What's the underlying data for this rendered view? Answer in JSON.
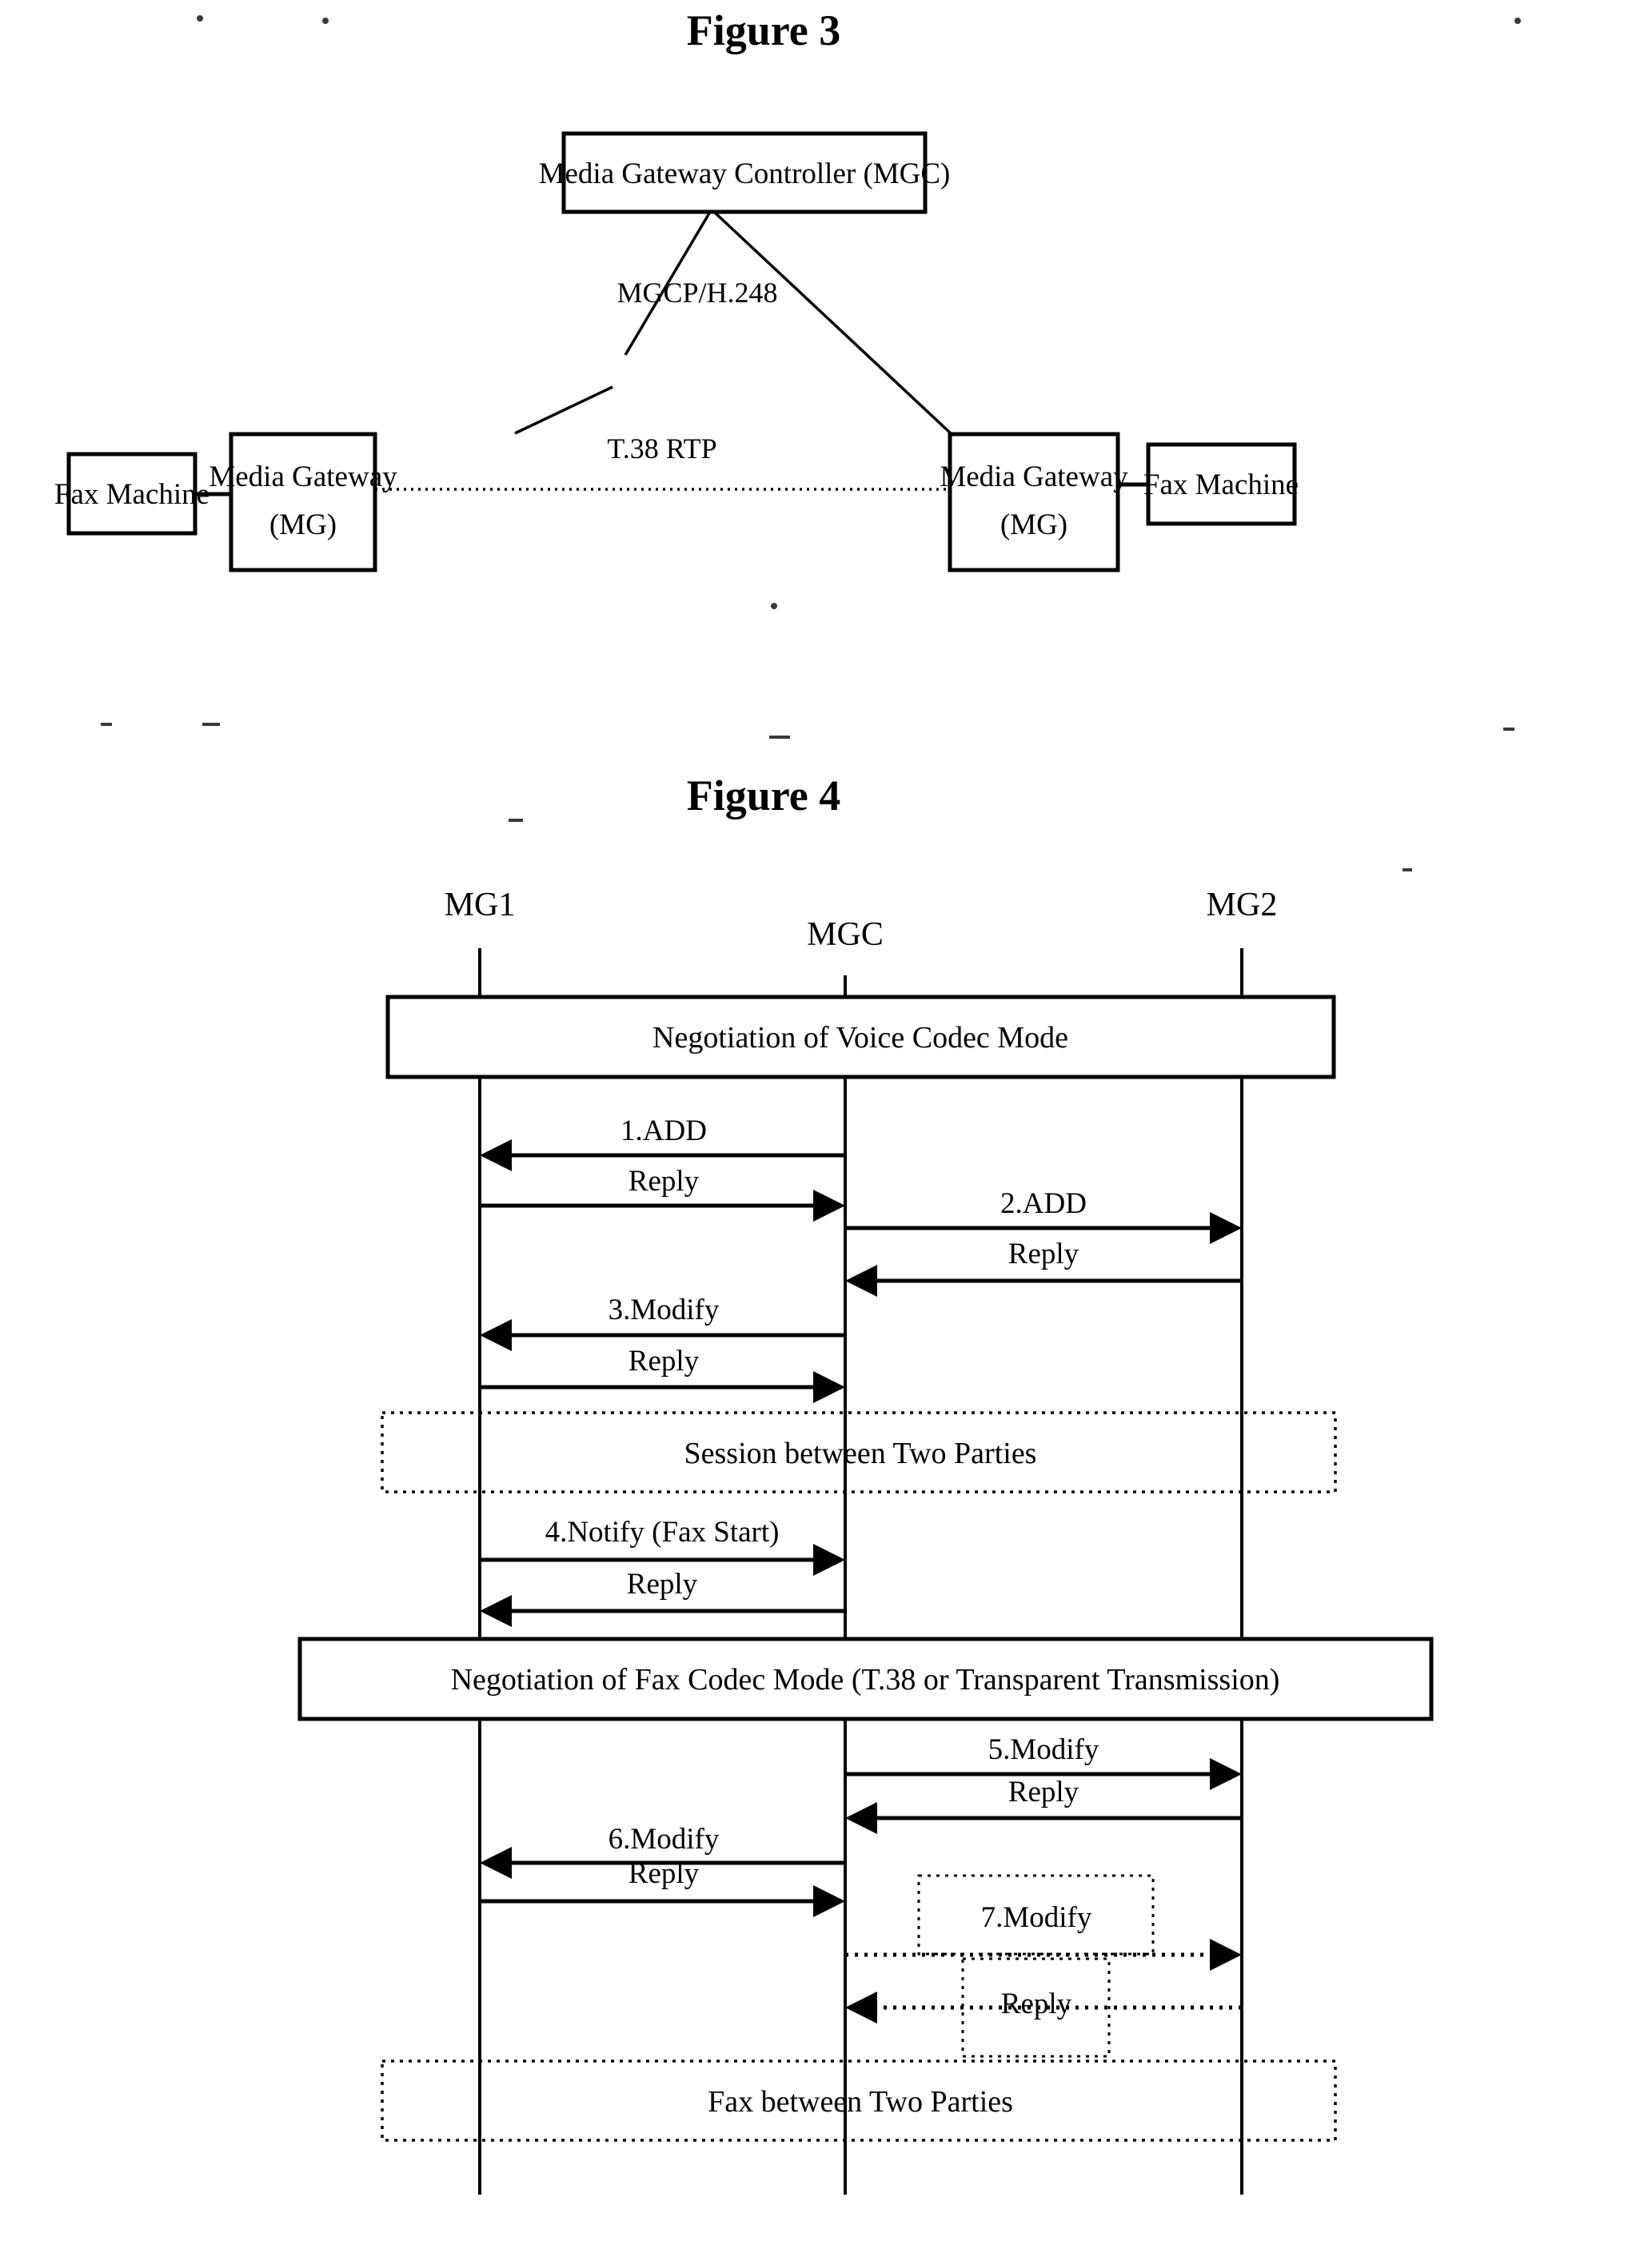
{
  "figure3": {
    "title": "Figure 3",
    "nodes": {
      "mgc": "Media Gateway Controller (MGC)",
      "mg_left_line1": "Media Gateway",
      "mg_left_line2": "(MG)",
      "mg_right_line1": "Media Gateway",
      "mg_right_line2": "(MG)",
      "fax_left": "Fax Machine",
      "fax_right": "Fax Machine"
    },
    "links": {
      "control_protocol": "MGCP/H.248",
      "media_path": "T.38 RTP"
    }
  },
  "figure4": {
    "title": "Figure 4",
    "lifelines": [
      {
        "id": "mg1",
        "label": "MG1"
      },
      {
        "id": "mgc",
        "label": "MGC"
      },
      {
        "id": "mg2",
        "label": "MG2"
      }
    ],
    "phases": [
      {
        "id": "voice-negotiation",
        "label": "Negotiation of Voice Codec Mode",
        "style": "solid"
      },
      {
        "id": "session",
        "label": "Session between Two Parties",
        "style": "dotted"
      },
      {
        "id": "fax-negotiation",
        "label": "Negotiation of Fax Codec Mode (T.38 or Transparent Transmission)",
        "style": "solid"
      },
      {
        "id": "fax-transfer",
        "label": "Fax between Two Parties",
        "style": "dotted"
      }
    ],
    "messages": [
      {
        "id": "m1",
        "label": "1.ADD",
        "from": "mgc",
        "to": "mg1",
        "style": "solid"
      },
      {
        "id": "m1r",
        "label": "Reply",
        "from": "mg1",
        "to": "mgc",
        "style": "solid"
      },
      {
        "id": "m2",
        "label": "2.ADD",
        "from": "mgc",
        "to": "mg2",
        "style": "solid"
      },
      {
        "id": "m2r",
        "label": "Reply",
        "from": "mg2",
        "to": "mgc",
        "style": "solid"
      },
      {
        "id": "m3",
        "label": "3.Modify",
        "from": "mgc",
        "to": "mg1",
        "style": "solid"
      },
      {
        "id": "m3r",
        "label": "Reply",
        "from": "mg1",
        "to": "mgc",
        "style": "solid"
      },
      {
        "id": "m4",
        "label": "4.Notify (Fax Start)",
        "from": "mg1",
        "to": "mgc",
        "style": "solid"
      },
      {
        "id": "m4r",
        "label": "Reply",
        "from": "mgc",
        "to": "mg1",
        "style": "solid"
      },
      {
        "id": "m5",
        "label": "5.Modify",
        "from": "mgc",
        "to": "mg2",
        "style": "solid"
      },
      {
        "id": "m5r",
        "label": "Reply",
        "from": "mg2",
        "to": "mgc",
        "style": "solid"
      },
      {
        "id": "m6",
        "label": "6.Modify",
        "from": "mgc",
        "to": "mg1",
        "style": "solid"
      },
      {
        "id": "m6r",
        "label": "Reply",
        "from": "mg1",
        "to": "mgc",
        "style": "solid"
      },
      {
        "id": "m7",
        "label": "7.Modify",
        "from": "mgc",
        "to": "mg2",
        "style": "dotted"
      },
      {
        "id": "m7r",
        "label": "Reply",
        "from": "mg2",
        "to": "mgc",
        "style": "dotted"
      }
    ]
  }
}
